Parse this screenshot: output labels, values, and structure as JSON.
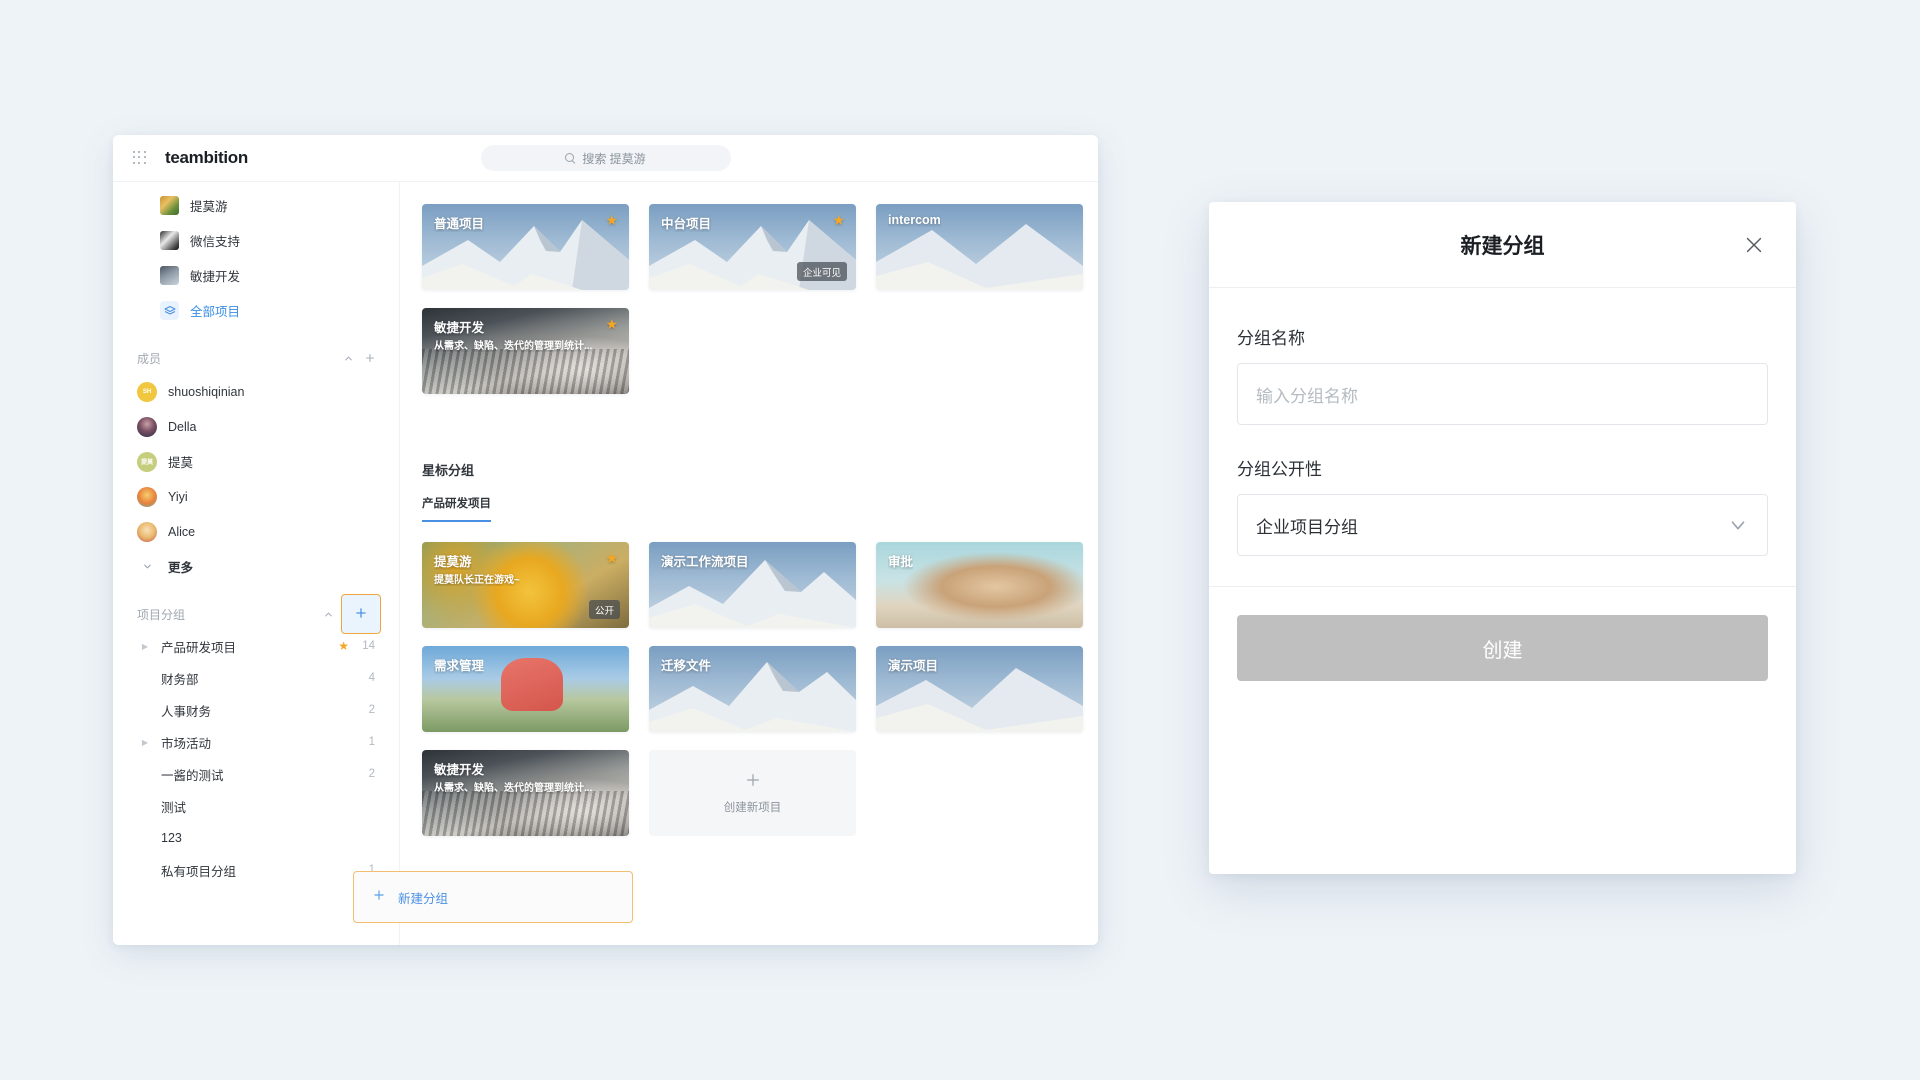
{
  "app": {
    "brand": "teambition",
    "grid_icon": "apps-grid-icon",
    "search": {
      "icon": "search-icon",
      "placeholder": "搜索 提莫游"
    }
  },
  "sidebar": {
    "recent_projects": [
      {
        "label": "提莫游",
        "icon": "project-thumb-temo"
      },
      {
        "label": "微信支持",
        "icon": "project-thumb-wechat"
      },
      {
        "label": "敏捷开发",
        "icon": "project-thumb-agile"
      }
    ],
    "all_projects": {
      "label": "全部项目",
      "icon": "layers-icon"
    },
    "members_section": {
      "title": "成员",
      "collapse_icon": "chevron-up-icon",
      "add_icon": "plus-icon",
      "items": [
        {
          "label": "shuoshiqinian",
          "initials": "SH"
        },
        {
          "label": "Della",
          "initials": ""
        },
        {
          "label": "提莫",
          "initials": "提莫"
        },
        {
          "label": "Yiyi",
          "initials": ""
        },
        {
          "label": "Alice",
          "initials": ""
        }
      ],
      "more_label": "更多",
      "more_icon": "chevron-down-icon"
    },
    "groups_section": {
      "title": "项目分组",
      "collapse_icon": "chevron-up-icon",
      "add_icon": "plus-icon",
      "items": [
        {
          "label": "产品研发项目",
          "count": "14",
          "starred": true,
          "expandable": true
        },
        {
          "label": "财务部",
          "count": "4",
          "starred": false,
          "expandable": false
        },
        {
          "label": "人事财务",
          "count": "2",
          "starred": false,
          "expandable": false
        },
        {
          "label": "市场活动",
          "count": "1",
          "starred": false,
          "expandable": true
        },
        {
          "label": "一酱的测试",
          "count": "2",
          "starred": false,
          "expandable": false
        },
        {
          "label": "测试",
          "count": "",
          "starred": false,
          "expandable": false
        },
        {
          "label": "123",
          "count": "",
          "starred": false,
          "expandable": false
        },
        {
          "label": "私有项目分组",
          "count": "1",
          "starred": false,
          "expandable": false
        }
      ]
    },
    "new_group_button": {
      "label": "新建分组",
      "icon": "plus-icon"
    }
  },
  "main": {
    "top_cards": [
      {
        "title": "普通项目",
        "subtitle": "",
        "starred": true,
        "badge": "",
        "art": "mtn"
      },
      {
        "title": "中台项目",
        "subtitle": "",
        "starred": true,
        "badge": "企业可见",
        "art": "mtn"
      },
      {
        "title": "intercom",
        "subtitle": "",
        "starred": false,
        "badge": "",
        "art": "plain"
      },
      {
        "title": "敏捷开发",
        "subtitle": "从需求、缺陷、迭代的管理到统计...",
        "starred": true,
        "badge": "",
        "art": "laptop"
      }
    ],
    "star_section_title": "星标分组",
    "tabs": [
      {
        "label": "产品研发项目",
        "active": true
      }
    ],
    "star_cards": [
      {
        "title": "提莫游",
        "subtitle": "提莫队长正在游戏~",
        "starred": true,
        "badge": "公开",
        "art": "temo"
      },
      {
        "title": "演示工作流项目",
        "subtitle": "",
        "starred": false,
        "badge": "",
        "art": "mtn"
      },
      {
        "title": "审批",
        "subtitle": "",
        "starred": false,
        "badge": "",
        "art": "mushroom"
      },
      {
        "title": "需求管理",
        "subtitle": "",
        "starred": false,
        "badge": "",
        "art": "demand"
      },
      {
        "title": "迁移文件",
        "subtitle": "",
        "starred": false,
        "badge": "",
        "art": "mtn"
      },
      {
        "title": "演示项目",
        "subtitle": "",
        "starred": false,
        "badge": "",
        "art": "mtn"
      },
      {
        "title": "敏捷开发",
        "subtitle": "从需求、缺陷、迭代的管理到统计...",
        "starred": false,
        "badge": "",
        "art": "laptop"
      }
    ],
    "new_project_card": {
      "label": "创建新项目",
      "icon": "plus-icon"
    }
  },
  "modal": {
    "title": "新建分组",
    "close_icon": "close-icon",
    "name_label": "分组名称",
    "name_placeholder": "输入分组名称",
    "name_value": "",
    "visibility_label": "分组公开性",
    "visibility_value": "企业项目分组",
    "visibility_icon": "chevron-down-icon",
    "submit_label": "创建"
  },
  "colors": {
    "page_bg": "#eef3f7",
    "accent_blue": "#4a90e2",
    "highlight_orange": "#f0a640",
    "star_gold": "#f5a623",
    "disabled_gray": "#bfbfbf"
  }
}
